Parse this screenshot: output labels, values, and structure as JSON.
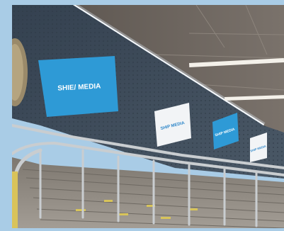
{
  "scene": {
    "description_colors": {
      "frame_background": "#a9cce6",
      "wall": "#3d4a57",
      "ceiling": "#6b645e",
      "poster_blue": "#2e9ad6",
      "poster_white": "#f2f4f6",
      "stairs": "#8f8a83",
      "rail": "#c9cdd0"
    }
  },
  "posters": [
    {
      "label": "SHIE/ MEDIA"
    },
    {
      "label": "SHIP MEDIA"
    },
    {
      "label": "SHIP MEDIA"
    },
    {
      "label": "SHIP MEDIA"
    }
  ]
}
